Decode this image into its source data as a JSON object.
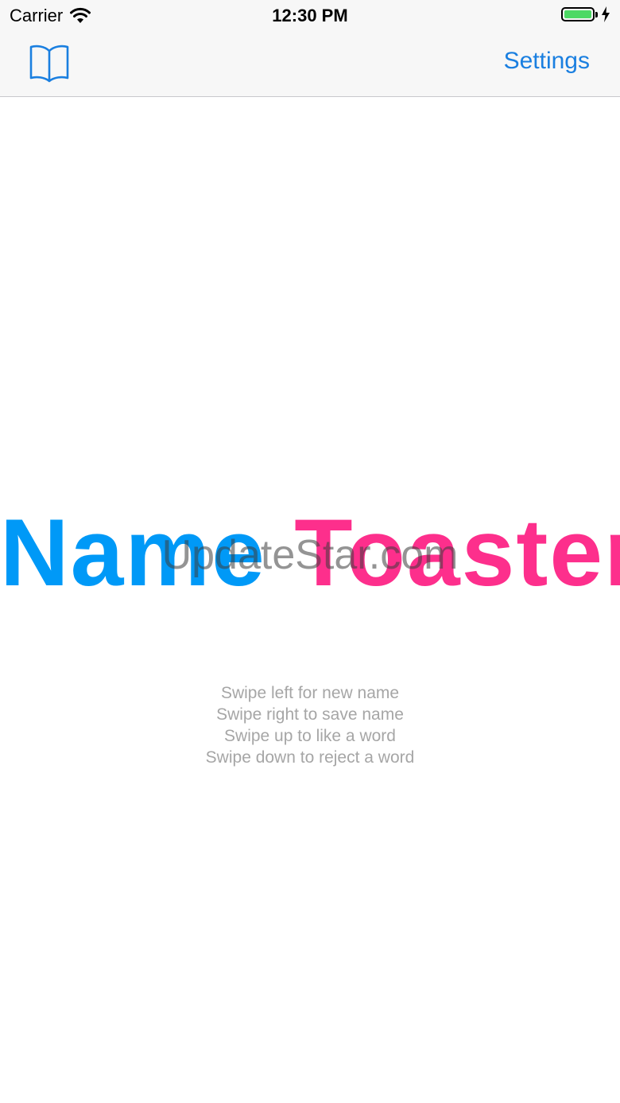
{
  "status_bar": {
    "carrier": "Carrier",
    "time": "12:30 PM",
    "battery_level": 1.0,
    "battery_color": "#4cd964",
    "icons": [
      "wifi-icon",
      "battery-icon",
      "charging-bolt-icon"
    ]
  },
  "nav": {
    "left_icon": "book-icon",
    "settings_label": "Settings",
    "accent_color": "#1a7fe0"
  },
  "title": {
    "part1": "Name",
    "part2": "Toaster",
    "part1_color": "#0099f7",
    "part2_color": "#fd2f8c"
  },
  "watermark": "UpdateStar.com",
  "instructions": [
    "Swipe left for new name",
    "Swipe right to save name",
    "Swipe up to like a word",
    "Swipe down to reject a word"
  ]
}
